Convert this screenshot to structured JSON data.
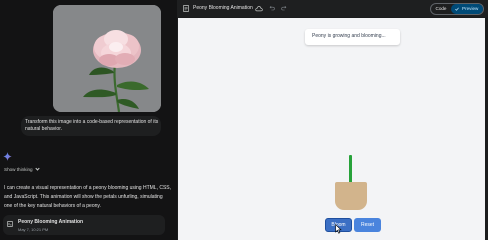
{
  "chat": {
    "prompt": "Transform this image into a code-based representation of its natural behavior.",
    "show_thinking_label": "Show thinking",
    "response": "I can create a visual representation of a peony blooming using HTML, CSS, and JavaScript. This animation will show the petals unfurling, simulating one of the key natural behaviors of a peony.",
    "artifact": {
      "title": "Peony Blooming Animation",
      "date": "May 7, 10:21 PM"
    }
  },
  "canvas": {
    "title": "Peony Blooming Animation",
    "toggle": {
      "code_label": "Code",
      "preview_label": "Preview",
      "selected": "Preview"
    },
    "preview": {
      "status_text": "Peony is growing and blooming...",
      "bloom_button": "Bloom",
      "reset_button": "Reset"
    }
  },
  "icons": {
    "gemini": "gemini-spark-icon",
    "doc": "document-icon",
    "cloud": "cloud-icon",
    "undo": "undo-icon",
    "redo": "redo-icon",
    "check": "check-icon",
    "artifact": "code-icon"
  },
  "colors": {
    "dark_bg": "#131314",
    "accent_blue": "#004a77",
    "button_blue": "#3b6fc4",
    "stem_green": "#27a23a",
    "pot_tan": "#d2b48c"
  }
}
